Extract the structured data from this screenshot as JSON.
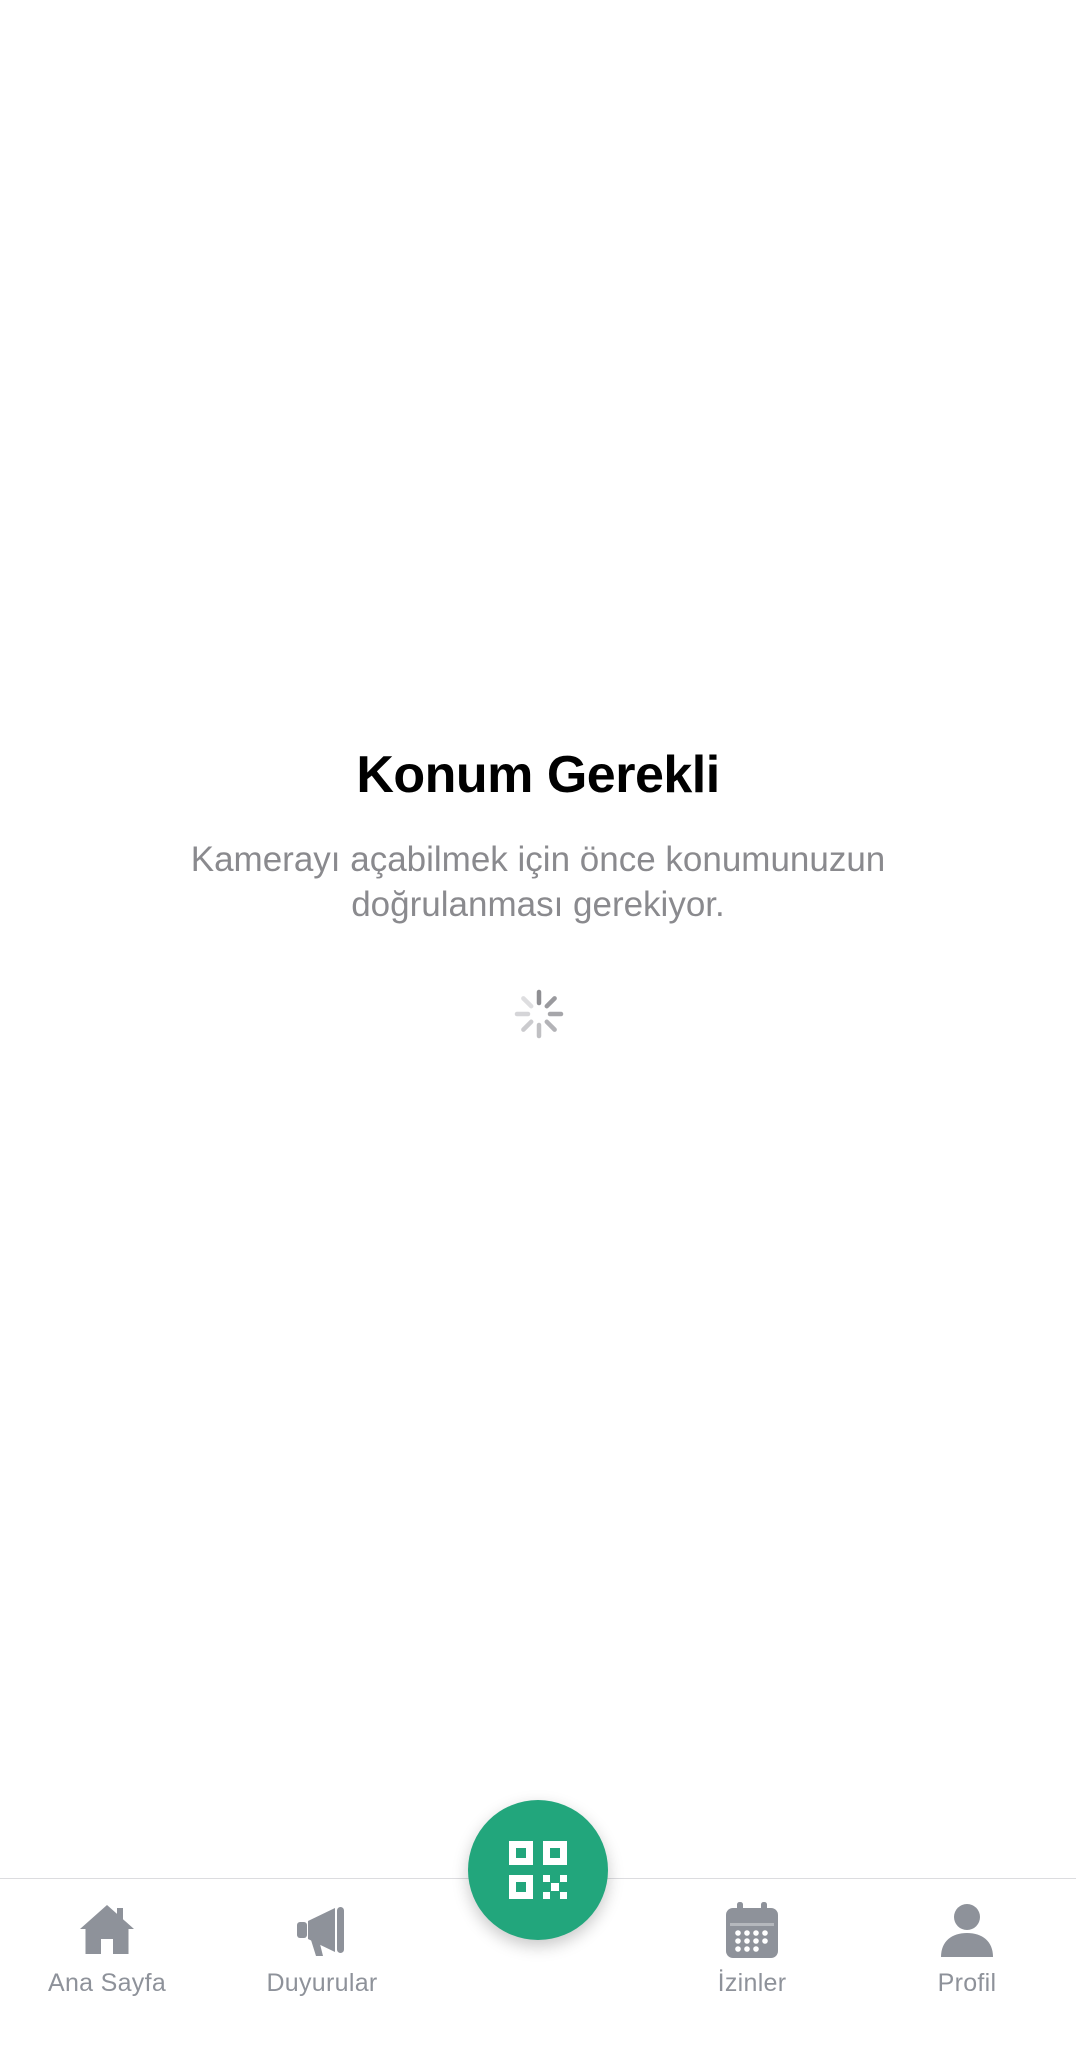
{
  "main": {
    "title": "Konum Gerekli",
    "message": "Kamerayı açabilmek için önce konumunuzun doğrulanması gerekiyor.",
    "spinner_icon": "activity-spinner-icon"
  },
  "tabbar": {
    "tabs": [
      {
        "label": "Ana Sayfa",
        "icon": "home-icon"
      },
      {
        "label": "Duyurular",
        "icon": "megaphone-icon"
      },
      {
        "label": "İzinler",
        "icon": "calendar-icon"
      },
      {
        "label": "Profil",
        "icon": "person-icon"
      }
    ],
    "center_button_icon": "qr-code-icon"
  },
  "colors": {
    "accent": "#22a67c",
    "tab_inactive": "#8e929a",
    "message_text": "#8a8a8e",
    "title_text": "#000000"
  }
}
